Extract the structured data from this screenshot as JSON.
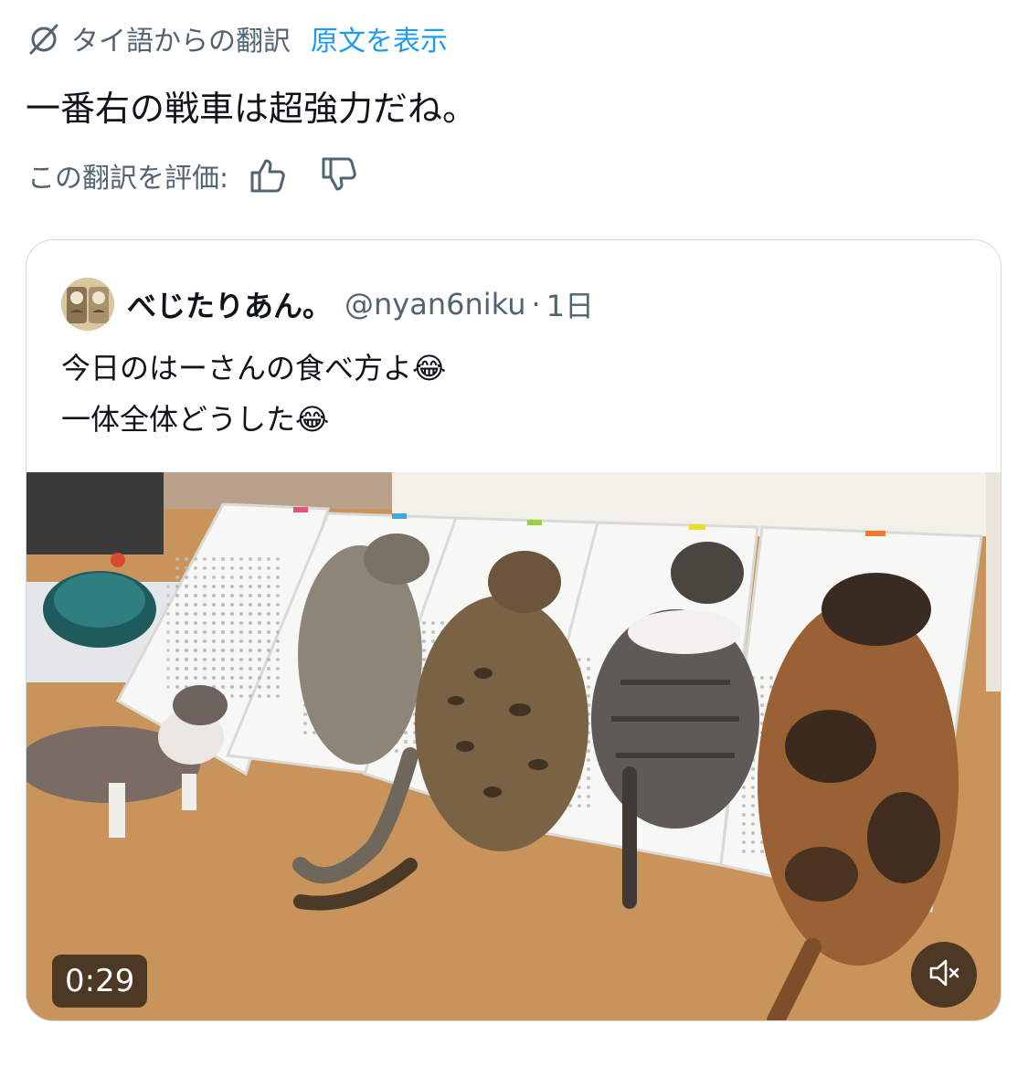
{
  "translation": {
    "label": "タイ語からの翻訳",
    "show_original": "原文を表示",
    "text": "一番右の戦車は超強力だね。",
    "rate_label": "この翻訳を評価:"
  },
  "quote": {
    "display_name": "べじたりあん。",
    "handle": "@nyan6niku",
    "separator": "·",
    "time": "1日",
    "line1": "今日のはーさんの食べ方よ",
    "line2": "一体全体どうした",
    "emoji": "😂"
  },
  "video": {
    "duration": "0:29",
    "mute_icon": "speaker-muted-icon"
  },
  "colors": {
    "link": "#1d9bf0",
    "secondary_text": "#536471",
    "border": "#cfd9de"
  }
}
